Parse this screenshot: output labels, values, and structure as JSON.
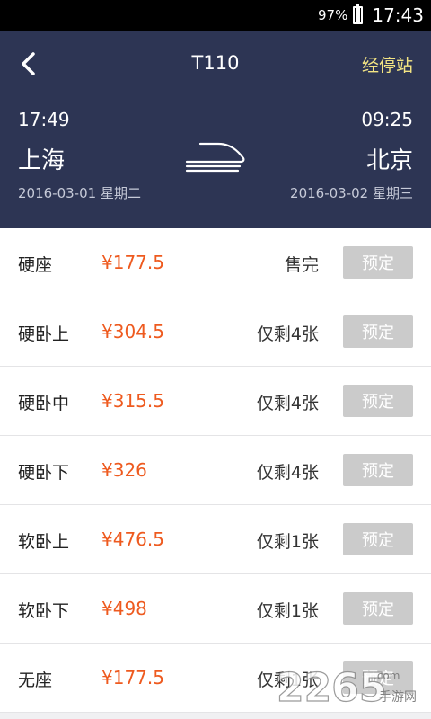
{
  "status_bar": {
    "battery": "97%",
    "time": "17:43"
  },
  "header": {
    "title": "T110",
    "stops_link": "经停站",
    "departure": {
      "time": "17:49",
      "city": "上海",
      "date": "2016-03-01 星期二"
    },
    "arrival": {
      "time": "09:25",
      "city": "北京",
      "date": "2016-03-02 星期三"
    }
  },
  "seats": [
    {
      "type": "硬座",
      "price": "¥177.5",
      "availability": "售完",
      "book": "预定"
    },
    {
      "type": "硬卧上",
      "price": "¥304.5",
      "availability": "仅剩4张",
      "book": "预定"
    },
    {
      "type": "硬卧中",
      "price": "¥315.5",
      "availability": "仅剩4张",
      "book": "预定"
    },
    {
      "type": "硬卧下",
      "price": "¥326",
      "availability": "仅剩4张",
      "book": "预定"
    },
    {
      "type": "软卧上",
      "price": "¥476.5",
      "availability": "仅剩1张",
      "book": "预定"
    },
    {
      "type": "软卧下",
      "price": "¥498",
      "availability": "仅剩1张",
      "book": "预定"
    },
    {
      "type": "无座",
      "price": "¥177.5",
      "availability": "仅剩1张",
      "book": "预定"
    }
  ],
  "watermark": {
    "brand": "2265",
    "suffix": ".com",
    "tagline": "手游网"
  },
  "colors": {
    "header_bg": "#2d3554",
    "price": "#ee5a1f",
    "stops_link": "#f3e483",
    "book_button": "#cbcbcb"
  }
}
